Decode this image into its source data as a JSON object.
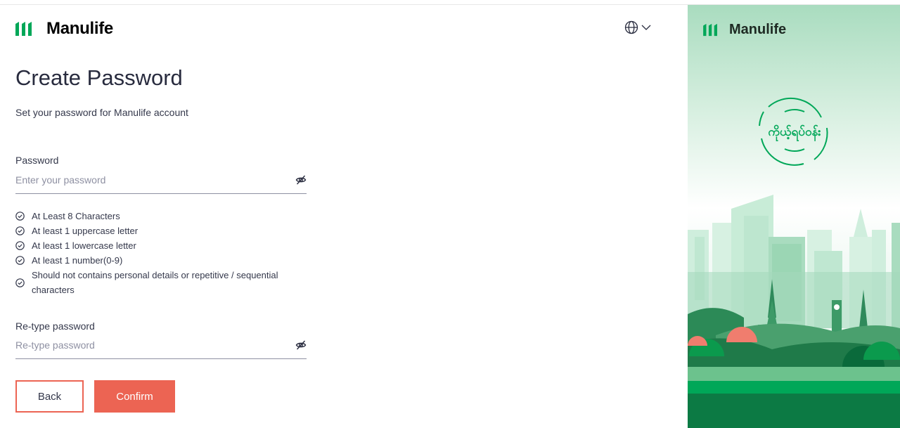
{
  "brand": {
    "name": "Manulife",
    "color": "#00a758",
    "dark_green": "#06874e"
  },
  "header": {
    "language_icon": "globe-icon",
    "language_chevron": "chevron-down-icon"
  },
  "page": {
    "title": "Create Password",
    "subtitle": "Set your password for Manulife account"
  },
  "password": {
    "label": "Password",
    "placeholder": "Enter your password",
    "value": "",
    "toggle_icon": "eye-off-icon"
  },
  "rules": [
    {
      "text": "At Least 8 Characters"
    },
    {
      "text": "At least 1 uppercase letter"
    },
    {
      "text": "At least 1 lowercase letter"
    },
    {
      "text": "At least 1 number(0-9)"
    },
    {
      "text": "Should not contains personal details or repetitive / sequential characters"
    }
  ],
  "retype": {
    "label": "Re-type password",
    "placeholder": "Re-type password",
    "value": "",
    "toggle_icon": "eye-off-icon"
  },
  "buttons": {
    "back": "Back",
    "confirm": "Confirm"
  },
  "colors": {
    "accent": "#ec6453",
    "text": "#34384b",
    "muted": "#8e90a2"
  },
  "side_panel": {
    "brand": "Manulife",
    "badge_text": "ကိုယ့်ရပ်ဝန်း",
    "illustration": "city-skyline-illustration"
  }
}
